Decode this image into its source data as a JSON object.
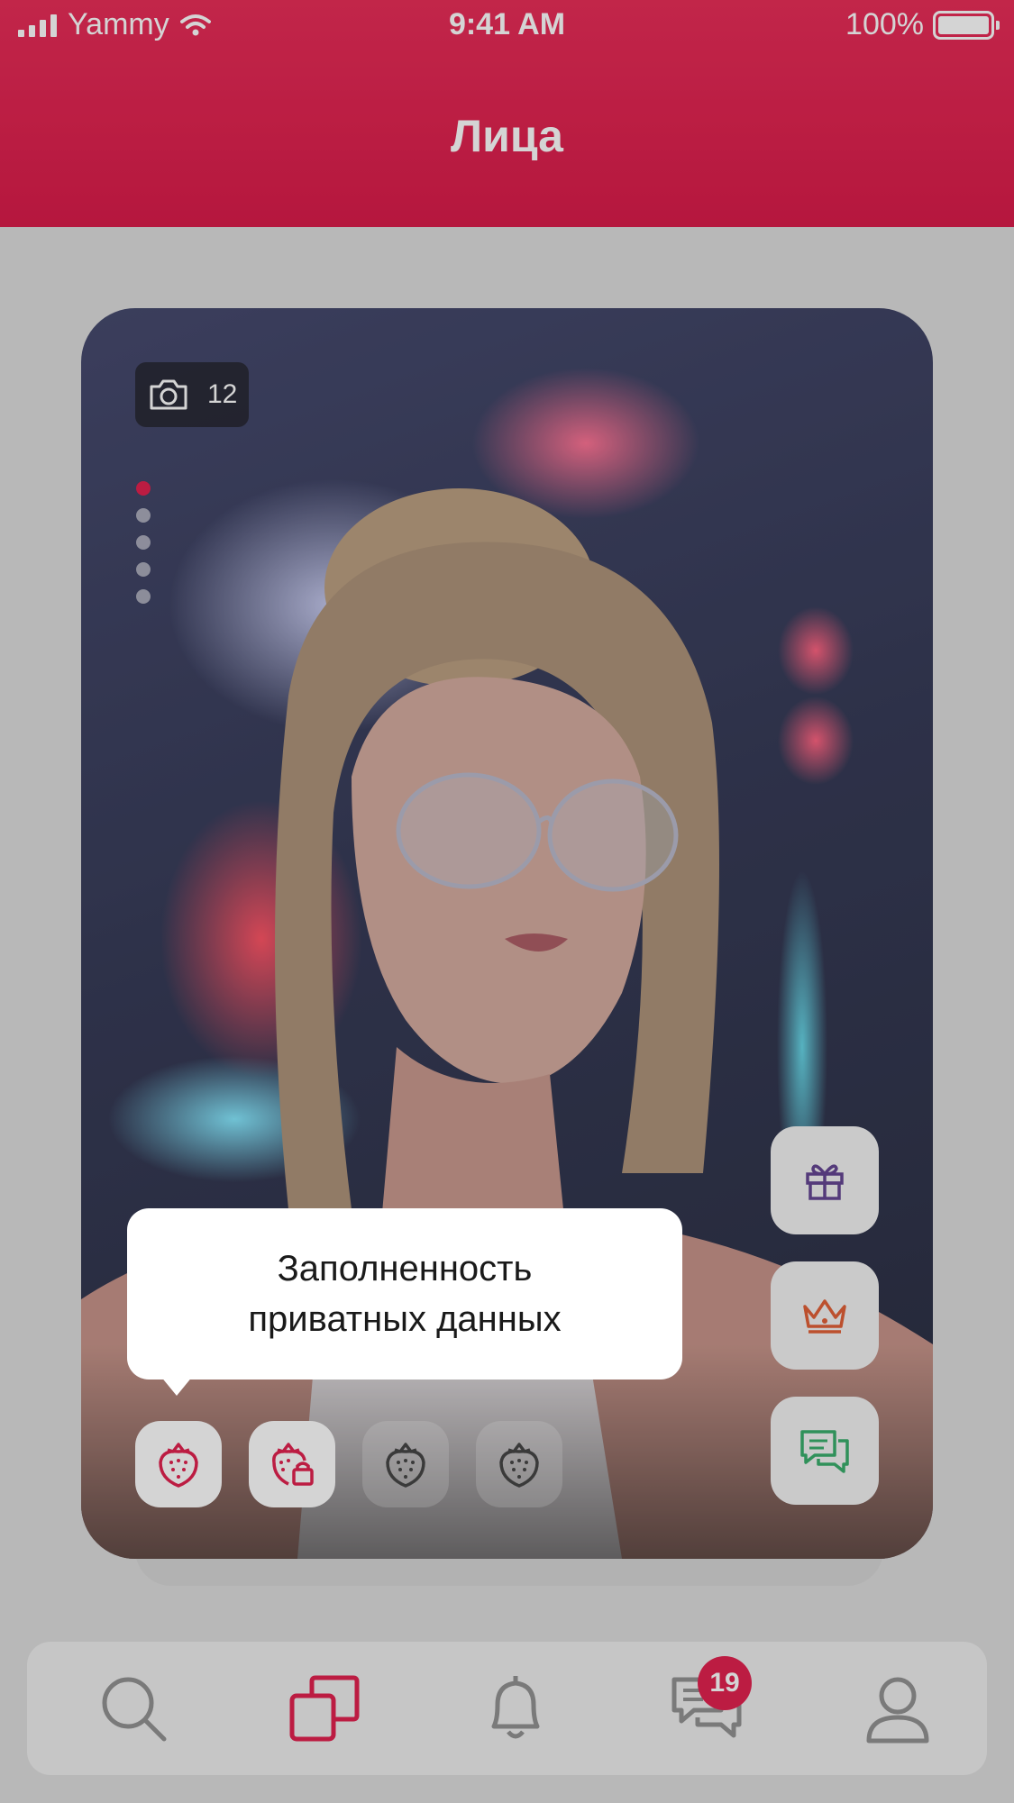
{
  "status_bar": {
    "carrier": "Yammy",
    "time": "9:41 AM",
    "battery": "100%"
  },
  "header": {
    "title": "Лица"
  },
  "card": {
    "photo_count": "12",
    "photo_index": 1,
    "photo_total_dots": 5
  },
  "tooltip": {
    "text": "Заполненность\nприватных данных"
  },
  "colors": {
    "brand": "#e01445",
    "gift_icon": "#5b3a8c",
    "crown_icon": "#e0572b",
    "chat_icon": "#2daa63"
  },
  "icons": {
    "side_buttons": [
      "gift-icon",
      "crown-icon",
      "chat-icon"
    ],
    "berries": [
      "strawberry-icon",
      "strawberry-lock-icon",
      "strawberry-icon",
      "strawberry-icon"
    ],
    "tabs": [
      "search-icon",
      "cards-icon",
      "bell-icon",
      "messages-icon",
      "profile-icon"
    ]
  },
  "tabbar": {
    "messages_badge": "19",
    "active_tab": "cards"
  }
}
